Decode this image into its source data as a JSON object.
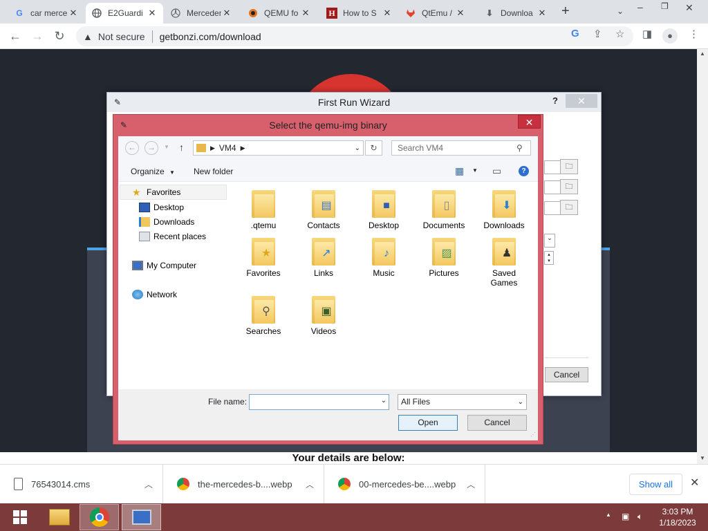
{
  "browser": {
    "tabs": [
      {
        "title": "car merce",
        "icon": "google-g-icon",
        "active": false
      },
      {
        "title": "E2Guardi",
        "icon": "globe-icon",
        "active": true
      },
      {
        "title": "Merceden",
        "icon": "mercedes-icon",
        "active": false
      },
      {
        "title": "QEMU fo",
        "icon": "qemu-icon",
        "active": false
      },
      {
        "title": "How to S",
        "icon": "hacker-h-icon",
        "active": false
      },
      {
        "title": "QtEmu /",
        "icon": "gitlab-icon",
        "active": false
      },
      {
        "title": "Downloa",
        "icon": "download-icon",
        "active": false
      }
    ],
    "security_label": "Not secure",
    "url": "getbonzi.com/download"
  },
  "page": {
    "details_heading": "Your details are below:"
  },
  "wizard": {
    "title": "First Run Wizard",
    "help": "?",
    "cancel_label": "Cancel"
  },
  "file_dialog": {
    "title": "Select the qemu-img binary",
    "address": {
      "folder": "VM4"
    },
    "search_placeholder": "Search VM4",
    "organize_label": "Organize",
    "new_folder_label": "New folder",
    "sidebar": {
      "favorites": "Favorites",
      "desktop": "Desktop",
      "downloads": "Downloads",
      "recent_places": "Recent places",
      "my_computer": "My Computer",
      "network": "Network"
    },
    "files": [
      {
        "name": ".qtemu",
        "icon": "folder-icon"
      },
      {
        "name": "Contacts",
        "icon": "contacts-folder-icon"
      },
      {
        "name": "Desktop",
        "icon": "desktop-folder-icon"
      },
      {
        "name": "Documents",
        "icon": "documents-folder-icon"
      },
      {
        "name": "Downloads",
        "icon": "downloads-folder-icon"
      },
      {
        "name": "Favorites",
        "icon": "favorites-folder-icon"
      },
      {
        "name": "Links",
        "icon": "links-folder-icon"
      },
      {
        "name": "Music",
        "icon": "music-folder-icon"
      },
      {
        "name": "Pictures",
        "icon": "pictures-folder-icon"
      },
      {
        "name": "Saved Games",
        "icon": "saved-games-folder-icon"
      },
      {
        "name": "Searches",
        "icon": "searches-folder-icon"
      },
      {
        "name": "Videos",
        "icon": "videos-folder-icon"
      }
    ],
    "file_name_label": "File name:",
    "file_name_value": "",
    "file_type": "All Files",
    "open_label": "Open",
    "cancel_label": "Cancel"
  },
  "downloads": {
    "items": [
      {
        "name": "76543014.cms"
      },
      {
        "name": "the-mercedes-b....webp"
      },
      {
        "name": "00-mercedes-be....webp"
      }
    ],
    "show_all_label": "Show all"
  },
  "taskbar": {
    "time": "3:03 PM",
    "date": "1/18/2023"
  }
}
